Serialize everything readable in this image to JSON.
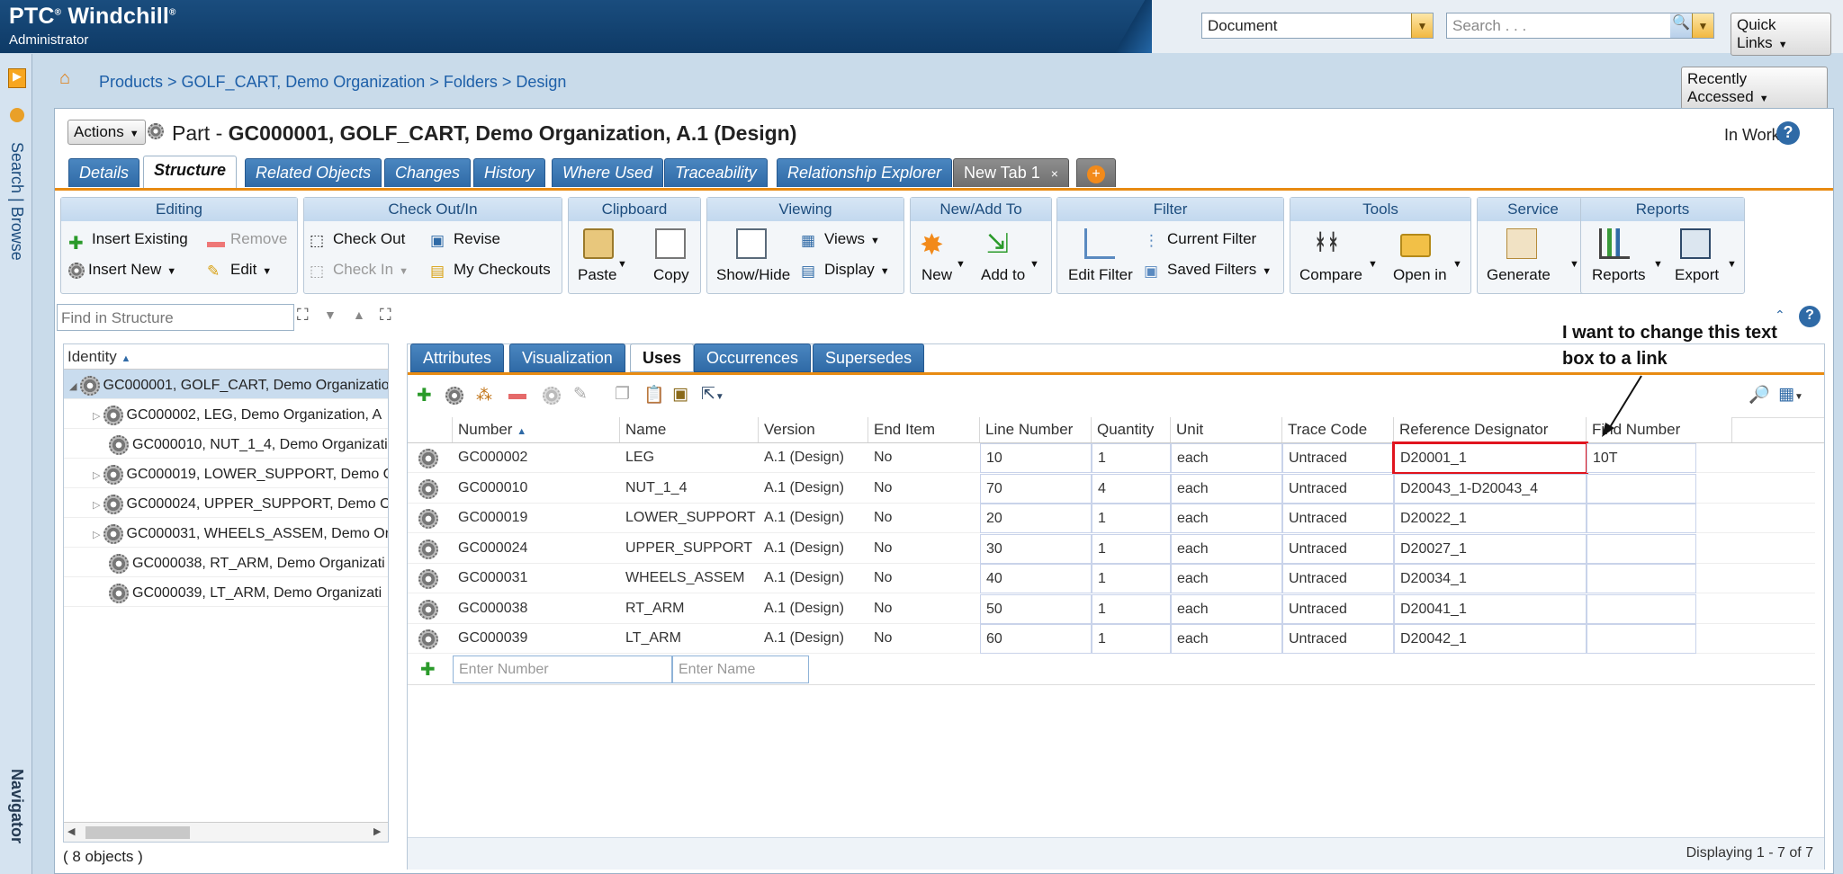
{
  "app": {
    "logo": "PTC",
    "logo_sup": "®",
    "product": " Windchill",
    "sup2": "®",
    "role": "Administrator"
  },
  "header": {
    "type_select": "Document",
    "search_placeholder": "Search . . .",
    "quick_links": "Quick Links",
    "recently_accessed": "Recently Accessed"
  },
  "breadcrumb": "Products > GOLF_CART, Demo Organization > Folders > Design",
  "nav": {
    "search": "Search | Browse",
    "navigator": "Navigator"
  },
  "page": {
    "actions": "Actions",
    "kind": "Part - ",
    "title": "GC000001, GOLF_CART, Demo Organization, A.1 (Design)",
    "state": "In Work"
  },
  "tabs": [
    "Details",
    "Structure",
    "Related Objects",
    "Changes",
    "History",
    "Where Used",
    "Traceability",
    "Relationship Explorer",
    "New Tab 1"
  ],
  "toolbar": {
    "editing": {
      "title": "Editing",
      "insert_existing": "Insert Existing",
      "remove": "Remove",
      "insert_new": "Insert New",
      "edit": "Edit"
    },
    "checkout": {
      "title": "Check Out/In",
      "check_out": "Check Out",
      "revise": "Revise",
      "check_in": "Check In",
      "my_checkouts": "My Checkouts"
    },
    "clipboard": {
      "title": "Clipboard",
      "paste": "Paste",
      "copy": "Copy"
    },
    "viewing": {
      "title": "Viewing",
      "show_hide": "Show/Hide",
      "views": "Views",
      "display": "Display"
    },
    "newadd": {
      "title": "New/Add To",
      "new": "New",
      "add_to": "Add to"
    },
    "filter": {
      "title": "Filter",
      "edit_filter": "Edit Filter",
      "current_filter": "Current Filter",
      "saved_filters": "Saved Filters"
    },
    "tools": {
      "title": "Tools",
      "compare": "Compare",
      "open_in": "Open in"
    },
    "service": {
      "title": "Service",
      "generate": "Generate"
    },
    "reports": {
      "title": "Reports",
      "reports": "Reports",
      "export": "Export"
    }
  },
  "find": {
    "placeholder": "Find in Structure"
  },
  "tree": {
    "header": "Identity",
    "rows": [
      "GC000001, GOLF_CART, Demo Organizatio",
      "GC000002, LEG, Demo Organization, A",
      "GC000010, NUT_1_4, Demo Organizati",
      "GC000019, LOWER_SUPPORT, Demo C",
      "GC000024, UPPER_SUPPORT, Demo Or",
      "GC000031, WHEELS_ASSEM, Demo Org",
      "GC000038, RT_ARM, Demo Organizati",
      "GC000039, LT_ARM, Demo Organizati"
    ],
    "count": "( 8 objects )"
  },
  "subtabs": [
    "Attributes",
    "Visualization",
    "Uses",
    "Occurrences",
    "Supersedes"
  ],
  "table": {
    "columns": [
      "Number",
      "Name",
      "Version",
      "End Item",
      "Line Number",
      "Quantity",
      "Unit",
      "Trace Code",
      "Reference Designator",
      "Find Number"
    ],
    "rows": [
      [
        "GC000002",
        "LEG",
        "A.1 (Design)",
        "No",
        "10",
        "1",
        "each",
        "Untraced",
        "D20001_1",
        "10T"
      ],
      [
        "GC000010",
        "NUT_1_4",
        "A.1 (Design)",
        "No",
        "70",
        "4",
        "each",
        "Untraced",
        "D20043_1-D20043_4",
        ""
      ],
      [
        "GC000019",
        "LOWER_SUPPORT",
        "A.1 (Design)",
        "No",
        "20",
        "1",
        "each",
        "Untraced",
        "D20022_1",
        ""
      ],
      [
        "GC000024",
        "UPPER_SUPPORT",
        "A.1 (Design)",
        "No",
        "30",
        "1",
        "each",
        "Untraced",
        "D20027_1",
        ""
      ],
      [
        "GC000031",
        "WHEELS_ASSEM",
        "A.1 (Design)",
        "No",
        "40",
        "1",
        "each",
        "Untraced",
        "D20034_1",
        ""
      ],
      [
        "GC000038",
        "RT_ARM",
        "A.1 (Design)",
        "No",
        "50",
        "1",
        "each",
        "Untraced",
        "D20041_1",
        ""
      ],
      [
        "GC000039",
        "LT_ARM",
        "A.1 (Design)",
        "No",
        "60",
        "1",
        "each",
        "Untraced",
        "D20042_1",
        ""
      ]
    ],
    "enter_number": "Enter Number",
    "enter_name": "Enter Name",
    "status": "Displaying 1 - 7 of 7"
  },
  "annotation": {
    "line1": "I want to change this text",
    "line2": "box to a link"
  }
}
